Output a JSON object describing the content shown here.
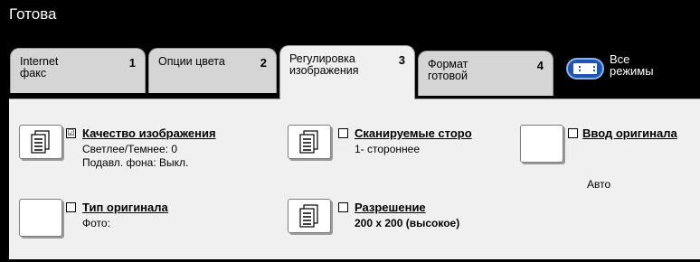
{
  "header": {
    "status": "Готова"
  },
  "tabs": [
    {
      "label": "Internet\nфакс",
      "num": "1"
    },
    {
      "label": "Опции цвета",
      "num": "2"
    },
    {
      "label": "Регулировка\nизображения",
      "num": "3"
    },
    {
      "label": "Формат\nготовой",
      "num": "4"
    }
  ],
  "all_services": {
    "label": "Все\nрежимы"
  },
  "features": {
    "image_quality": {
      "title": "Качество изображения",
      "line1": "Светлее/Темнее: 0",
      "line2": "Подавл. фона: Выкл.",
      "checked": "☑"
    },
    "scan_sides": {
      "title": "Сканируемые сторо",
      "line1": "1- стороннее"
    },
    "original_input": {
      "title": "Ввод оригинала",
      "line1": "Авто"
    },
    "original_type": {
      "title": "Тип оригинала",
      "line1": "Фото:"
    },
    "resolution": {
      "title": "Разрешение",
      "line1": "200 x 200 (высокое)"
    }
  }
}
